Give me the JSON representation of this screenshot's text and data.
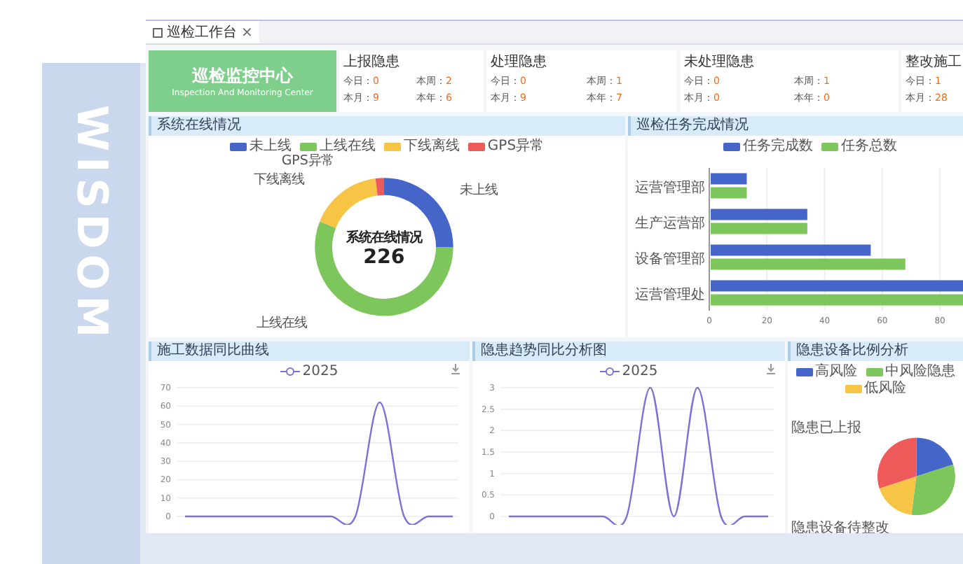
{
  "backdrop": {
    "text": "WISDOM"
  },
  "tab": {
    "label": "巡检工作台",
    "close": "×"
  },
  "logo": {
    "title": "巡检监控中心",
    "subtitle": "Inspection And Monitoring Center"
  },
  "stat_cards": [
    {
      "title": "上报隐患",
      "items": [
        {
          "label": "今日：",
          "value": "0"
        },
        {
          "label": "本周：",
          "value": "2"
        },
        {
          "label": "本月：",
          "value": "9"
        },
        {
          "label": "本年：",
          "value": "6"
        }
      ]
    },
    {
      "title": "处理隐患",
      "items": [
        {
          "label": "今日：",
          "value": "0"
        },
        {
          "label": "本周：",
          "value": "1"
        },
        {
          "label": "本月：",
          "value": "9"
        },
        {
          "label": "本年：",
          "value": "7"
        }
      ]
    },
    {
      "title": "未处理隐患",
      "items": [
        {
          "label": "今日：",
          "value": "0"
        },
        {
          "label": "本周：",
          "value": "1"
        },
        {
          "label": "本月：",
          "value": "0"
        },
        {
          "label": "本年：",
          "value": "0"
        }
      ]
    },
    {
      "title": "整改施工",
      "items": [
        {
          "label": "今日：",
          "value": "1"
        },
        {
          "label": "本月：",
          "value": "28"
        }
      ]
    }
  ],
  "online_panel": {
    "title": "系统在线情况",
    "legend": [
      {
        "label": "未上线",
        "color": "#4565c8"
      },
      {
        "label": "上线在线",
        "color": "#7cc65b"
      },
      {
        "label": "下线离线",
        "color": "#f7c545"
      },
      {
        "label": "GPS异常",
        "color": "#ee5a5a"
      }
    ],
    "center_title": "系统在线情况",
    "center_value": "226",
    "slice_labels": [
      "GPS异常",
      "下线离线",
      "未上线",
      "上线在线"
    ]
  },
  "task_panel": {
    "title": "巡检任务完成情况",
    "chart_data": {
      "type": "bar",
      "orientation": "horizontal",
      "categories": [
        "运营管理部",
        "生产运营部",
        "设备管理部",
        "运营管理处"
      ],
      "series": [
        {
          "name": "任务完成数",
          "color": "#4565c8",
          "values": [
            13,
            34,
            56,
            88
          ]
        },
        {
          "name": "任务总数",
          "color": "#7cc65b",
          "values": [
            13,
            34,
            68,
            88
          ]
        }
      ],
      "xlim": [
        0,
        88
      ],
      "xticks": [
        0,
        20,
        40,
        60,
        80
      ],
      "grid": true
    }
  },
  "construction_panel": {
    "title": "施工数据同比曲线",
    "chart_data": {
      "type": "line",
      "series": [
        {
          "name": "2025",
          "color": "#7b72d8",
          "values": [
            0,
            0,
            0,
            0,
            0,
            0,
            0,
            0,
            62,
            0,
            0,
            0
          ]
        }
      ],
      "ylim": [
        0,
        70
      ],
      "yticks": [
        0,
        10,
        20,
        30,
        40,
        50,
        60,
        70
      ],
      "grid": true
    }
  },
  "trend_panel": {
    "title": "隐患趋势同比分析图",
    "chart_data": {
      "type": "line",
      "series": [
        {
          "name": "2025",
          "color": "#7b72d8",
          "values": [
            0,
            0,
            0,
            0,
            0,
            0,
            3,
            0,
            3,
            0,
            0,
            0
          ]
        }
      ],
      "ylim": [
        0,
        3
      ],
      "yticks": [
        0,
        0.5,
        1,
        1.5,
        2,
        2.5,
        3
      ],
      "grid": true
    }
  },
  "device_panel": {
    "title": "隐患设备比例分析",
    "legend": [
      {
        "label": "高风险",
        "color": "#4565c8"
      },
      {
        "label": "中风险隐患",
        "color": "#7cc65b"
      },
      {
        "label": "低风险",
        "color": "#f7c545"
      }
    ],
    "slice_labels": [
      "隐患已上报",
      "隐患设备待整改"
    ]
  }
}
